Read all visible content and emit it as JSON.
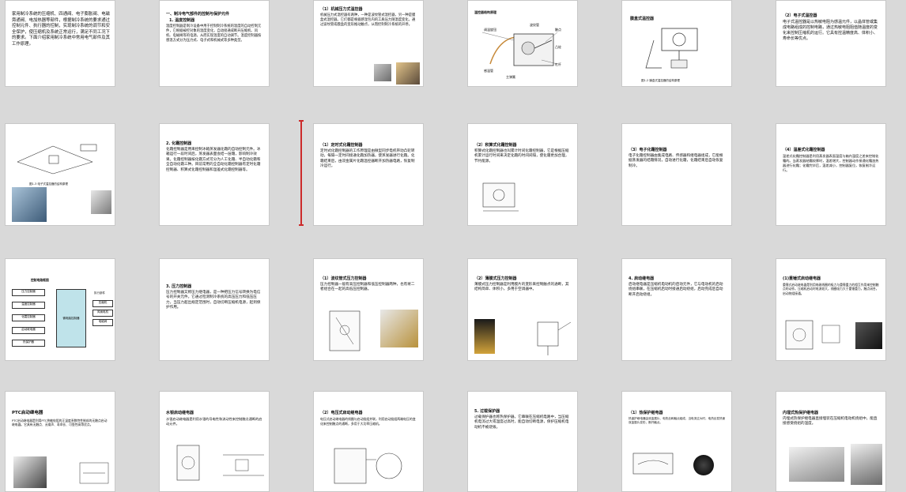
{
  "slides": {
    "s1": {
      "text": "家用制冷系统的压缩机、四通阀、电子膨胀阀、电磁旁通阀、电加热器等部件，根据制冷系统的要求通过控制元件、执行器的控制，实现制冷系统的调节和安全保护，使压缩机及系统正常运行，满足不同工况下的要求。下面介绍家用制冷系统中常用电气部件及其工作原理。"
    },
    "s2": {
      "title": "一、制冷电气部件的控制与保护元件",
      "subtitle": "1. 温度控制器",
      "text": "温度控制器是制冷设备中用于控制制冷系统的温度的自动控制元件，它根据被控对象的温度变化，自动接通或断开压缩机、风机、电磁阀等的电源，从而实现温度的自动调节。温度控制器按感温方式分为压力式、电子式和机械式等多种类型。"
    },
    "s3": {
      "title": "（1）机械压力式温控器",
      "text": "机械压力式温控器有两种，一种是波纹管式温控器，另一种是膜盒式温控器。它们都是根据感温包内的工质压力随温度变化，通过波纹管或膜盒的变形推动触点，从而控制制冷系统的开停。"
    },
    "s4": {
      "title": "温控器结构原理",
      "labels": [
        "调温旋钮",
        "波纹管",
        "感温管",
        "触点",
        "主弹簧",
        "凸轮",
        "杠杆"
      ]
    },
    "s5": {
      "title": "膜盒式温控器",
      "caption": "图1-2 膜盒式温控器的结构原理"
    },
    "s6": {
      "title": "（2）电子式温控器",
      "text": "电子式温控器是以热敏电阻为感温元件，以晶体管或集成电路组成的控制电路，通过热敏电阻阻值随温度的变化来控制压缩机的运行。它具有控温精度高、体积小、寿命长等优点。"
    },
    "s7": {
      "caption": "图1-3 电子式温控器的结构原理"
    },
    "s8": {
      "title": "2. 化霜控制器",
      "text": "化霜控制器是用来控制冰箱蒸发器化霜的自动控制元件。冰箱运行一段时间后，蒸发器表面会结一层霜，影响制冷效果。化霜控制器按化霜方式可分为人工化霜、半自动化霜和全自动化霜三种。目前常用的全自动化霜控制器有定时化霜控制器、积算式化霜控制器和温差式化霜控制器等。"
    },
    "s9": {
      "title": "（1）定时式化霜控制器",
      "text": "定时式化霜控制器的工作原理是由微型同步电机带动凸轮转动，每隔一定时间接通化霜加热器，使蒸发器进行化霜。化霜结束后，由双金属片化霜温控器断开加热器电路，恢复制冷运行。"
    },
    "s10": {
      "title": "（2）积算式化霜控制器",
      "text": "积算式化霜控制器也叫累计时间化霜控制器，它是根据压缩机累计运行时间来决定化霜的时间间隔，使化霜更加合理，节约能源。"
    },
    "s11": {
      "title": "（3）电子化霜控制器",
      "text": "电子化霜控制器由集成电路、传感器和继电器组成，它能根据蒸发器的结霜情况，自动进行化霜，化霜结束后自动恢复制冷。"
    },
    "s12": {
      "title": "（4）温差式化霜控制器",
      "text": "温差式化霜控制器是利用蒸发器表面温度与箱内温度之差来控制化霜的。当蒸发器结霜较厚时，温差增大，控制器动作接通化霜加热器进行化霜；化霜完毕后，温差减小，控制器复位，恢复制冷运行。"
    },
    "s13": {
      "title": "控制电路框图",
      "left": [
        "压力控制器",
        "温度控制器",
        "化霜控制器",
        "启动继电器",
        "热保护器"
      ],
      "center": "微电脑控制器",
      "right_title": "执行部件",
      "right": [
        "压缩机",
        "风扇电机",
        "电磁阀"
      ]
    },
    "s14": {
      "title": "3. 压力控制器",
      "text": "压力控制器又称压力继电器，是一种把压力信号转换为电信号的开关元件。它通过检测制冷系统的高压压力和低压压力，当压力超出规定范围时，自动切断压缩机电源，起到保护作用。"
    },
    "s15": {
      "title": "（1）波纹管式压力控制器",
      "text": "压力控制器一般有高压控制器和低压控制器两种，也有将二者组合在一起的高低压控制器。"
    },
    "s16": {
      "title": "（2）薄膜式压力控制器",
      "text": "薄膜式压力控制器是利用膜片的变形来控制触点的通断，其结构简单、体积小，多用于空调器中。"
    },
    "s17": {
      "title": "4. 启动继电器",
      "text": "启动继电器是压缩机电动机的启动元件，它与电动机的启动绕组串联，在压缩机启动时接通启动绕组，启动完成后自动断开启动绕组。"
    },
    "s18": {
      "title": "(1)重锤式启动继电器",
      "text": "重锤式启动继电器是利用电磁线圈的吸力与重锤重力的相互作用来控制触点的动作。压缩机启动时电流较大，线圈吸力大于重锤重力，触点闭合，启动绕组接通。"
    },
    "s19": {
      "title": "PTC启动继电器",
      "text": "PTC启动继电器是利用PTC热敏电阻的正温度系数特性制成的无触点启动继电器。它具有无触点、无噪声、寿命长、可靠性高等优点。"
    },
    "s20": {
      "title": "水银启动继电器",
      "text": "水银启动继电器是利用水银的导电性和流动性来控制触点通断的启动元件。"
    },
    "s21": {
      "title": "（2）电压式启动继电器",
      "text": "电压式启动继电器的线圈与启动绕组并联，利用启动绕组两端电压的变化来控制触点的通断，多用于大功率压缩机。"
    },
    "s22": {
      "title": "5. 过载保护器",
      "text": "过载保护器也称热保护器，它串联在压缩机电路中，当压缩机电流过大或温度过高时，能自动切断电源，保护压缩机电动机不被烧毁。"
    },
    "s23": {
      "title": "（1）热保护继电器",
      "text": "热保护继电器由双金属片、电热丝和触点组成，当电流过大时，电热丝发热使双金属片变形，断开触点。"
    },
    "s24": {
      "title": "内埋式热保护继电器",
      "text": "内埋式热保护继电器直接埋装在压缩机电动机绕组中，能直接感受绕组的温度。"
    }
  }
}
